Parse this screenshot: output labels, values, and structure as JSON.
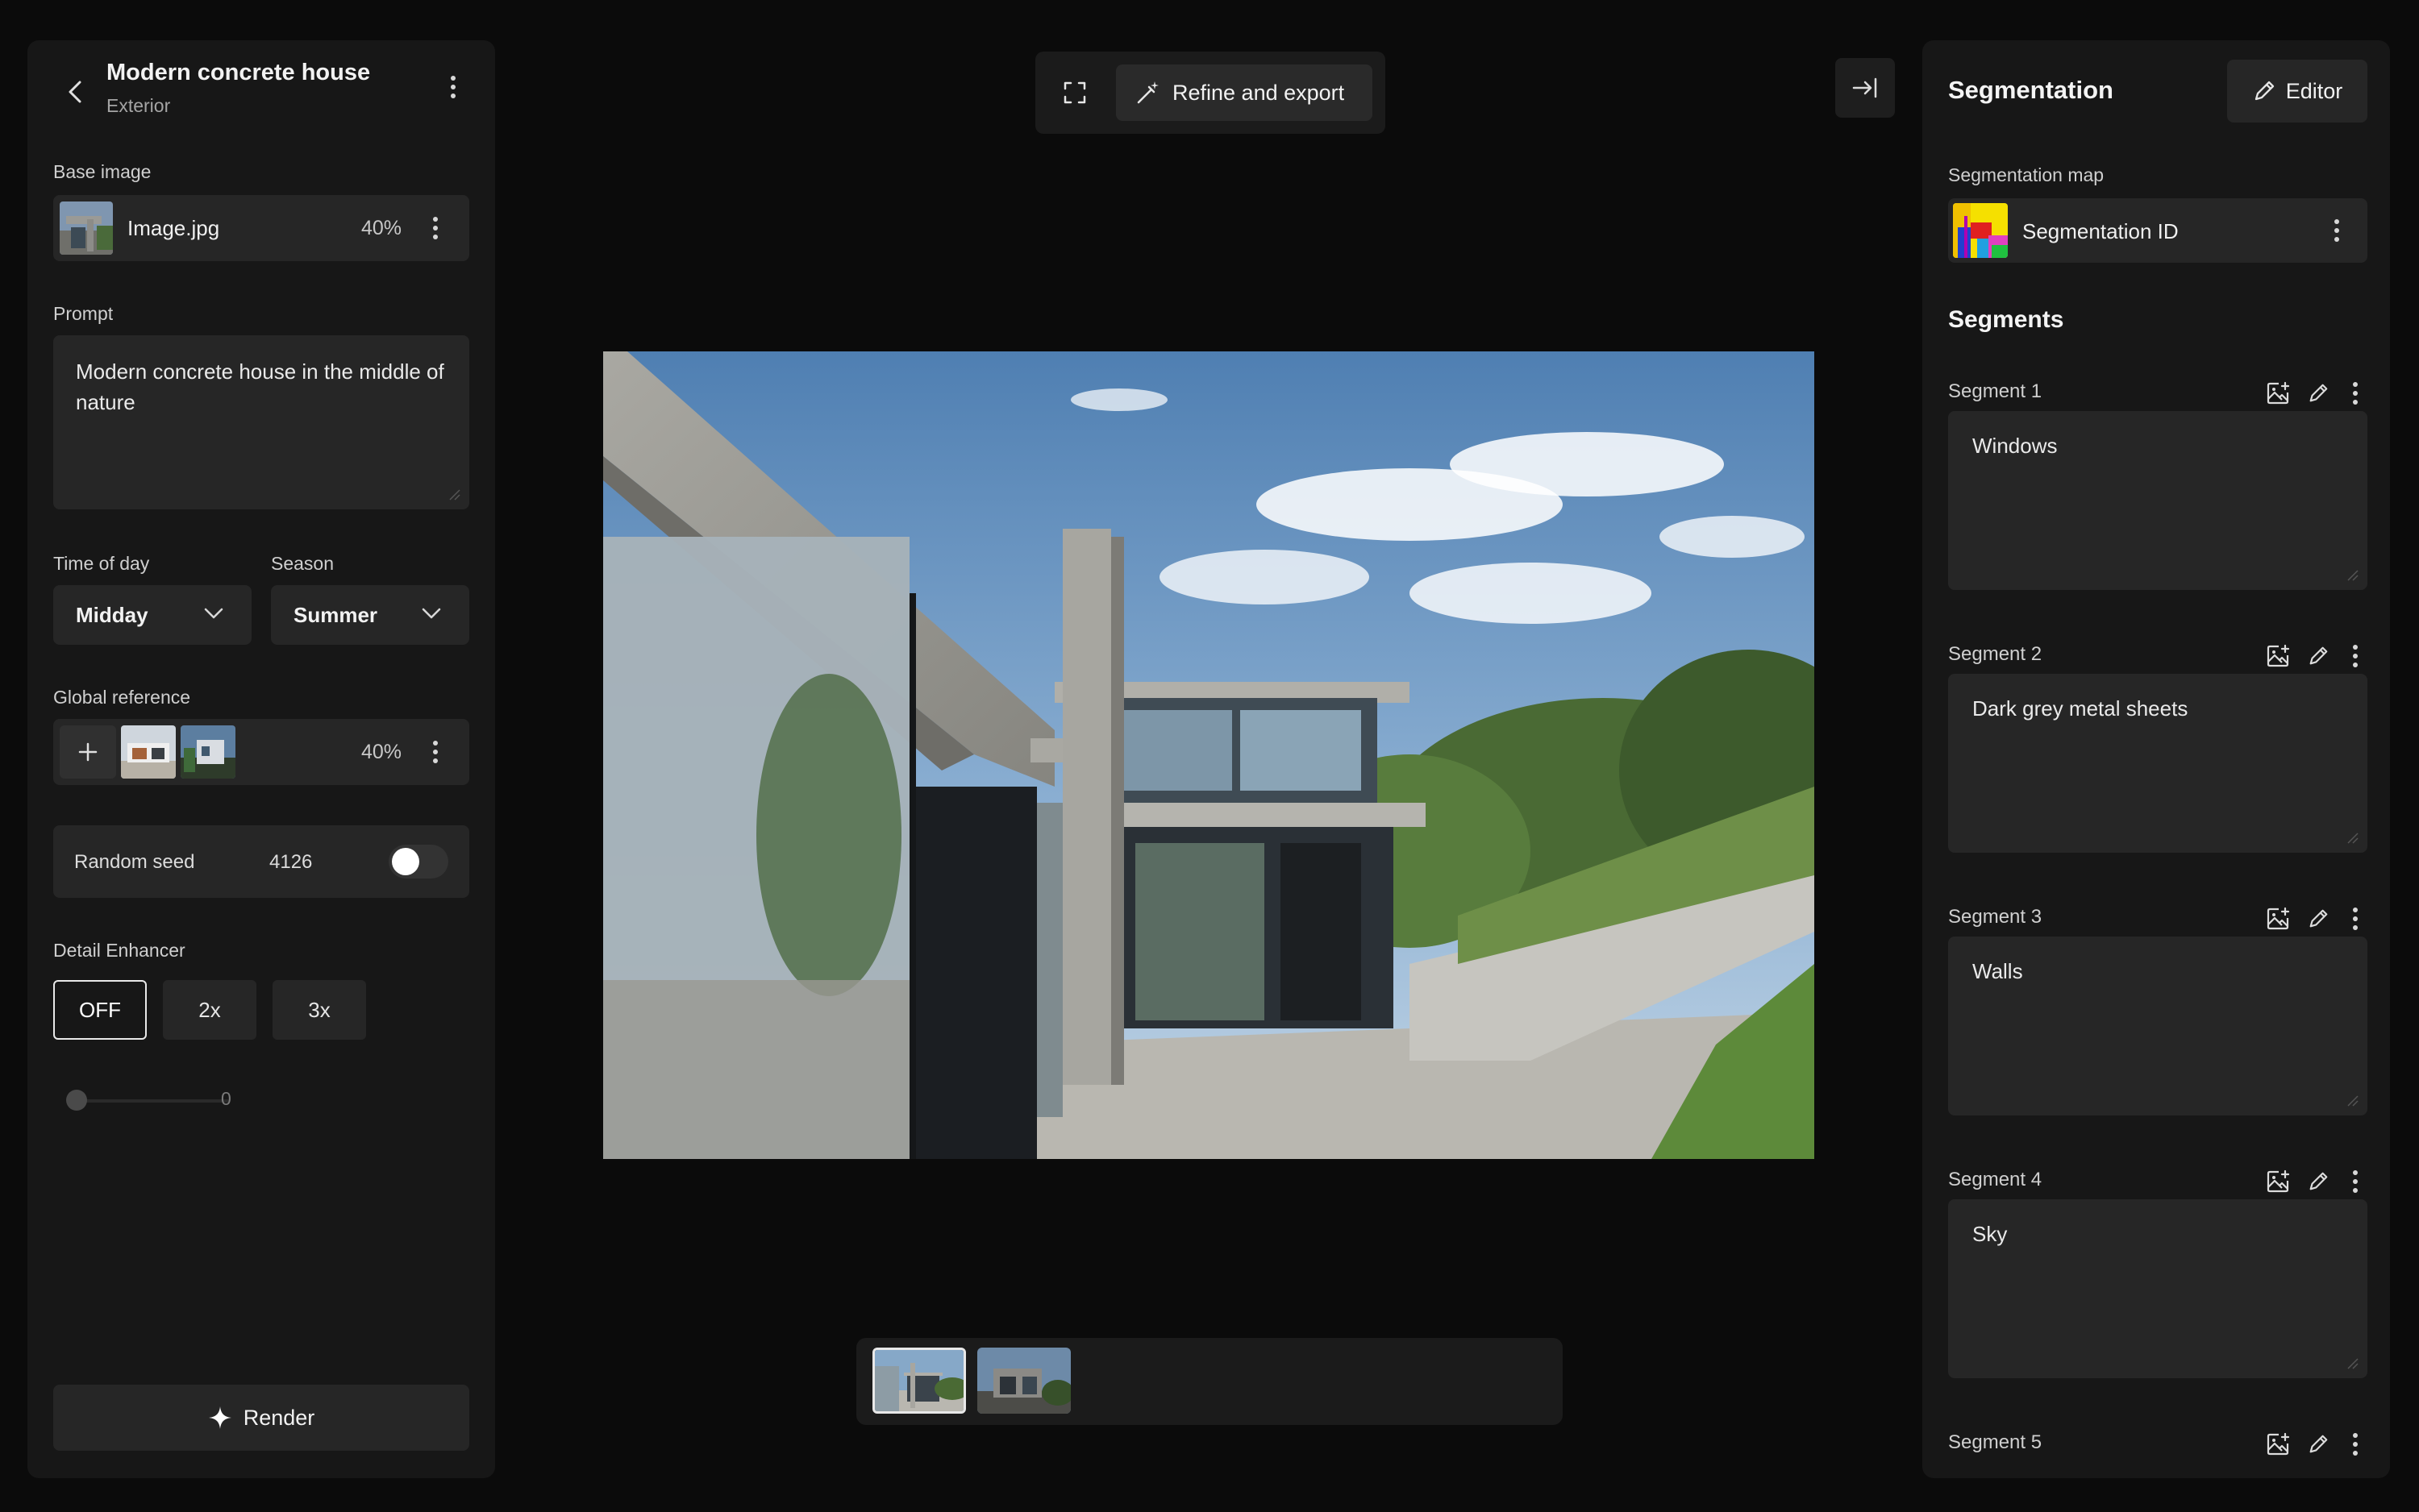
{
  "project": {
    "title": "Modern concrete house",
    "subtitle": "Exterior"
  },
  "left": {
    "base_image_label": "Base image",
    "base_image_name": "Image.jpg",
    "base_image_weight": "40%",
    "prompt_label": "Prompt",
    "prompt_text": "Modern concrete house in the middle of nature",
    "time_of_day_label": "Time of day",
    "time_of_day_value": "Midday",
    "season_label": "Season",
    "season_value": "Summer",
    "global_reference_label": "Global reference",
    "global_reference_weight": "40%",
    "random_seed_label": "Random seed",
    "random_seed_value": "4126",
    "random_seed_enabled": false,
    "detail_enhancer_label": "Detail Enhancer",
    "detail_enhancer_options": [
      "OFF",
      "2x",
      "3x"
    ],
    "detail_enhancer_selected": "OFF",
    "slider_value": "0",
    "render_label": "Render"
  },
  "toolbar": {
    "refine_label": "Refine and export"
  },
  "right": {
    "title": "Segmentation",
    "editor_label": "Editor",
    "map_label": "Segmentation map",
    "map_value": "Segmentation ID",
    "segments_heading": "Segments",
    "segments": [
      {
        "label": "Segment 1",
        "text": "Windows"
      },
      {
        "label": "Segment 2",
        "text": "Dark grey metal sheets"
      },
      {
        "label": "Segment 3",
        "text": "Walls"
      },
      {
        "label": "Segment 4",
        "text": "Sky"
      },
      {
        "label": "Segment 5",
        "text": ""
      }
    ]
  },
  "colors": {
    "background": "#0b0b0b",
    "panel": "#171717",
    "field": "#262626",
    "text": "#eaeaea"
  }
}
